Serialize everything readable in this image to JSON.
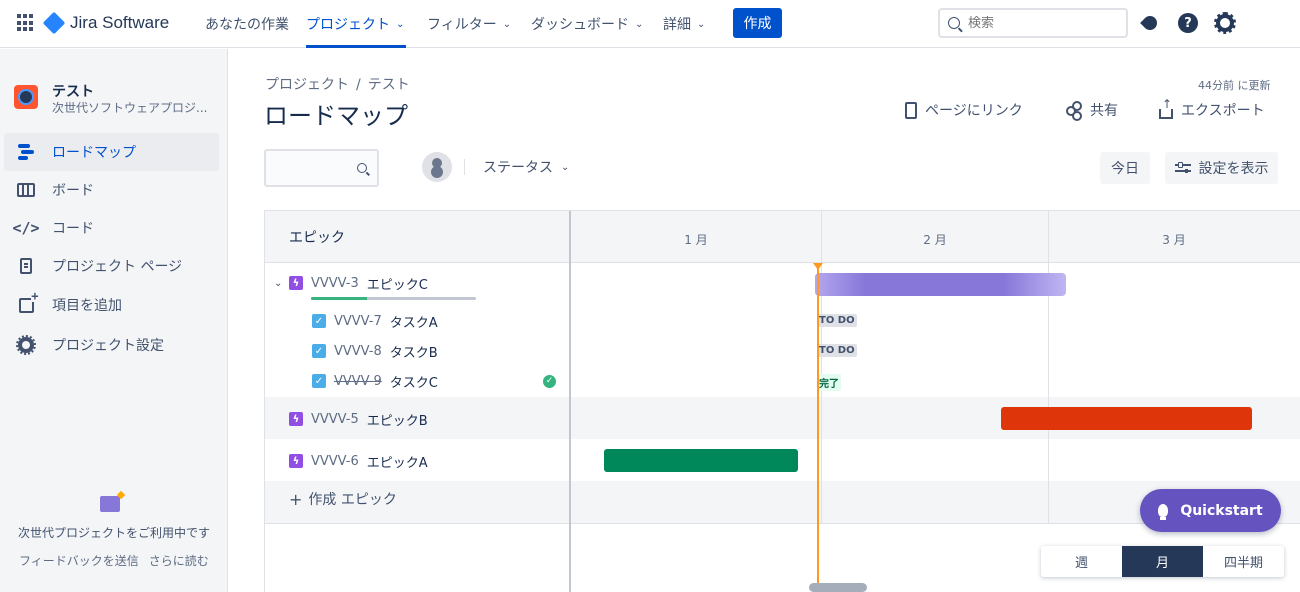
{
  "topnav": {
    "product": "Jira Software",
    "items": [
      {
        "label": "あなたの作業",
        "chevron": false
      },
      {
        "label": "プロジェクト",
        "chevron": true,
        "active": true
      },
      {
        "label": "フィルター",
        "chevron": true
      },
      {
        "label": "ダッシュボード",
        "chevron": true
      },
      {
        "label": "詳細",
        "chevron": true
      }
    ],
    "create_label": "作成",
    "search_placeholder": "検索",
    "icons": [
      "apps-icon",
      "rocket-icon",
      "help-icon",
      "settings-icon"
    ]
  },
  "sidebar": {
    "project_name": "テスト",
    "project_type": "次世代ソフトウェアプロジ...",
    "items": [
      {
        "label": "ロードマップ",
        "icon": "roadmap-icon",
        "active": true
      },
      {
        "label": "ボード",
        "icon": "board-icon"
      },
      {
        "label": "コード",
        "icon": "code-icon"
      },
      {
        "label": "プロジェクト ページ",
        "icon": "page-icon"
      },
      {
        "label": "項目を追加",
        "icon": "add-item-icon"
      },
      {
        "label": "プロジェクト設定",
        "icon": "gear-icon"
      }
    ],
    "footer_text": "次世代プロジェクトをご利用中です",
    "footer_links": [
      "フィードバックを送信",
      "さらに読む"
    ]
  },
  "header": {
    "breadcrumb": [
      "プロジェクト",
      "テスト"
    ],
    "breadcrumb_sep": "/",
    "title": "ロードマップ",
    "updated": "44分前 に更新",
    "actions": {
      "page_link": "ページにリンク",
      "share": "共有",
      "export": "エクスポート"
    }
  },
  "filters": {
    "search_value": "",
    "status_label": "ステータス",
    "today_label": "今日",
    "view_settings_label": "設定を表示"
  },
  "roadmap": {
    "epic_header": "エピック",
    "months": [
      "1 月",
      "2 月",
      "3 月"
    ],
    "epics": [
      {
        "key": "VVVV-3",
        "summary": "エピックC",
        "expanded": true,
        "progress": 0.34,
        "tasks": [
          {
            "key": "VVVV-7",
            "summary": "タスクA",
            "status": "TO DO"
          },
          {
            "key": "VVVV-8",
            "summary": "タスクB",
            "status": "TO DO"
          },
          {
            "key": "VVVV-9",
            "summary": "タスクC",
            "status": "完了",
            "done": true
          }
        ]
      },
      {
        "key": "VVVV-5",
        "summary": "エピックB"
      },
      {
        "key": "VVVV-6",
        "summary": "エピックA"
      }
    ],
    "create_epic_label": "作成 エピック",
    "create_epic_plus": "+"
  },
  "quickstart_label": "Quickstart",
  "time_scale": {
    "options": [
      "週",
      "月",
      "四半期"
    ],
    "selected": "月"
  },
  "colors": {
    "accent": "#0052cc",
    "epic_c": "#8777d9",
    "epic_b": "#de350b",
    "epic_a": "#00875a",
    "today": "#ff991f"
  }
}
